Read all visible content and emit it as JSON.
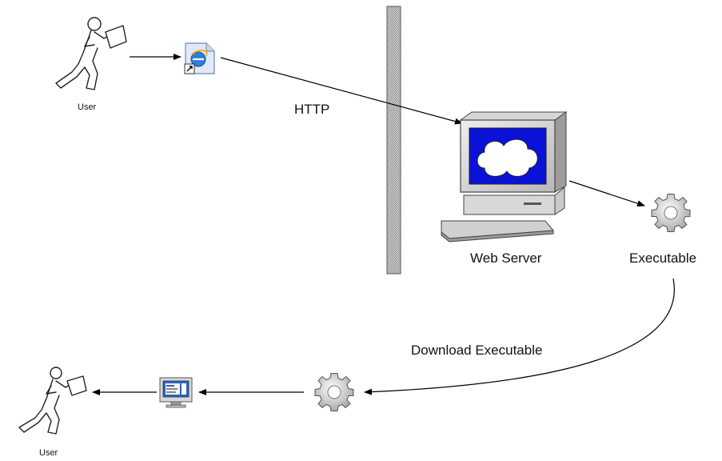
{
  "labels": {
    "user_top": "User",
    "http": "HTTP",
    "web_server": "Web Server",
    "executable": "Executable",
    "download_executable": "Download Executable",
    "user_bottom": "User"
  },
  "colors": {
    "line": "#000000",
    "firewall": "#9a9a9a",
    "monitor_body": "#cfcfcf",
    "screen": "#0a12d8",
    "cloud": "#ffffff"
  },
  "icons": {
    "user_figure": "person-carrying-box-icon",
    "browser": "internet-explorer-shortcut-icon",
    "server": "computer-monitor-icon",
    "gear": "gear-icon",
    "desktop": "desktop-window-icon",
    "firewall": "firewall-wall-icon"
  }
}
